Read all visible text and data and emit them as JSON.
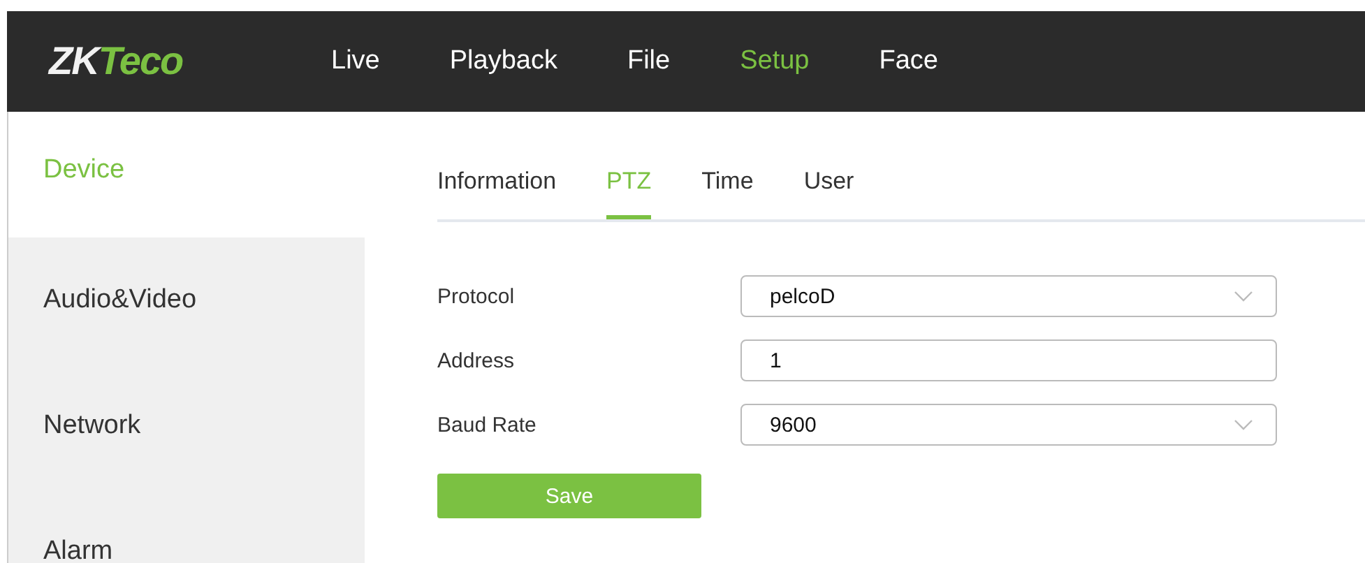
{
  "logo": {
    "primary": "ZK",
    "accent": "Teco"
  },
  "nav": [
    {
      "label": "Live",
      "selected": false
    },
    {
      "label": "Playback",
      "selected": false
    },
    {
      "label": "File",
      "selected": false
    },
    {
      "label": "Setup",
      "selected": true
    },
    {
      "label": "Face",
      "selected": false
    }
  ],
  "sidebar": {
    "items": [
      {
        "label": "Device",
        "selected": true
      },
      {
        "label": "Audio&Video",
        "selected": false
      },
      {
        "label": "Network",
        "selected": false
      },
      {
        "label": "Alarm",
        "selected": false
      }
    ]
  },
  "tabs": [
    {
      "label": "Information",
      "selected": false
    },
    {
      "label": "PTZ",
      "selected": true
    },
    {
      "label": "Time",
      "selected": false
    },
    {
      "label": "User",
      "selected": false
    }
  ],
  "form": [
    {
      "label": "Protocol",
      "kind": "select",
      "value": "pelcoD"
    },
    {
      "label": "Address",
      "kind": "text",
      "value": "1"
    },
    {
      "label": "Baud Rate",
      "kind": "select",
      "value": "9600"
    }
  ],
  "save_button": "Save"
}
